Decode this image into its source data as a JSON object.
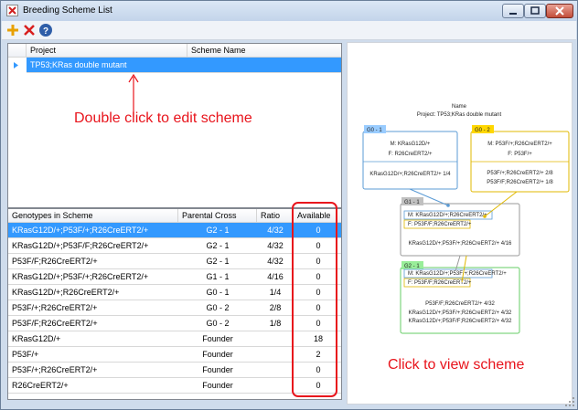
{
  "window": {
    "title": "Breeding Scheme List"
  },
  "toolbar": {
    "add_icon": "plus-icon",
    "delete_icon": "red-x-icon",
    "help_icon": "help-icon"
  },
  "projects_table": {
    "columns": [
      "Project",
      "Scheme Name"
    ],
    "rows": [
      {
        "project": "TP53;KRas double mutant",
        "scheme_name": "",
        "selected": true
      }
    ]
  },
  "genotypes_table": {
    "columns": [
      "Genotypes in Scheme",
      "Parental Cross",
      "Ratio",
      "Available"
    ],
    "rows": [
      {
        "genotype": "KRasG12D/+;P53F/+;R26CreERT2/+",
        "parental_cross": "G2 - 1",
        "ratio": "4/32",
        "available": "0",
        "selected": true
      },
      {
        "genotype": "KRasG12D/+;P53F/F;R26CreERT2/+",
        "parental_cross": "G2 - 1",
        "ratio": "4/32",
        "available": "0"
      },
      {
        "genotype": "P53F/F;R26CreERT2/+",
        "parental_cross": "G2 - 1",
        "ratio": "4/32",
        "available": "0"
      },
      {
        "genotype": "KRasG12D/+;P53F/+;R26CreERT2/+",
        "parental_cross": "G1 - 1",
        "ratio": "4/16",
        "available": "0"
      },
      {
        "genotype": "KRasG12D/+;R26CreERT2/+",
        "parental_cross": "G0 - 1",
        "ratio": "1/4",
        "available": "0"
      },
      {
        "genotype": "P53F/+;R26CreERT2/+",
        "parental_cross": "G0 - 2",
        "ratio": "2/8",
        "available": "0"
      },
      {
        "genotype": "P53F/F;R26CreERT2/+",
        "parental_cross": "G0 - 2",
        "ratio": "1/8",
        "available": "0"
      },
      {
        "genotype": "KRasG12D/+",
        "parental_cross": "Founder",
        "ratio": "",
        "available": "18"
      },
      {
        "genotype": "P53F/+",
        "parental_cross": "Founder",
        "ratio": "",
        "available": "2"
      },
      {
        "genotype": "P53F/+;R26CreERT2/+",
        "parental_cross": "Founder",
        "ratio": "",
        "available": "0"
      },
      {
        "genotype": "R26CreERT2/+",
        "parental_cross": "Founder",
        "ratio": "",
        "available": "0"
      }
    ]
  },
  "annotations": {
    "edit_hint": "Double click to edit scheme",
    "view_hint": "Click to view scheme"
  },
  "scheme": {
    "name_label": "Name",
    "project_label": "Project: TP53;KRas double mutant",
    "nodes": [
      {
        "tag": "G0 - 1",
        "tag_color": "#99ccff",
        "border_color": "#5b9bd5",
        "parents": [
          "M: KRasG12D/+",
          "F: R26CreERT2/+"
        ],
        "offspring": [
          "KRasG12D/+;R26CreERT2/+  1/4"
        ]
      },
      {
        "tag": "G0 - 2",
        "tag_color": "#ffd700",
        "border_color": "#e0b800",
        "parents": [
          "M: P53F/+;R26CreERT2/+",
          "F: P53F/+"
        ],
        "offspring": [
          "P53F/+;R26CreERT2/+  2/8",
          "P53F/F;R26CreERT2/+  1/8"
        ]
      },
      {
        "tag": "G1 - 1",
        "tag_color": "#c0c0c0",
        "border_color": "#999999",
        "parents": [
          "M: KRasG12D/+;R26CreERT2/+",
          "F: P53F/F;R26CreERT2/+"
        ],
        "offspring": [
          "KRasG12D/+;P53F/+;R26CreERT2/+  4/16"
        ]
      },
      {
        "tag": "G2 - 1",
        "tag_color": "#99ee99",
        "border_color": "#66cc66",
        "parents": [
          "M: KRasG12D/+;P53F/+;R26CreERT2/+",
          "F: P53F/F;R26CreERT2/+"
        ],
        "offspring": [
          "P53F/F;R26CreERT2/+  4/32",
          "KRasG12D/+;P53F/+;R26CreERT2/+  4/32",
          "KRasG12D/+;P53F/F;R26CreERT2/+  4/32"
        ]
      }
    ]
  }
}
